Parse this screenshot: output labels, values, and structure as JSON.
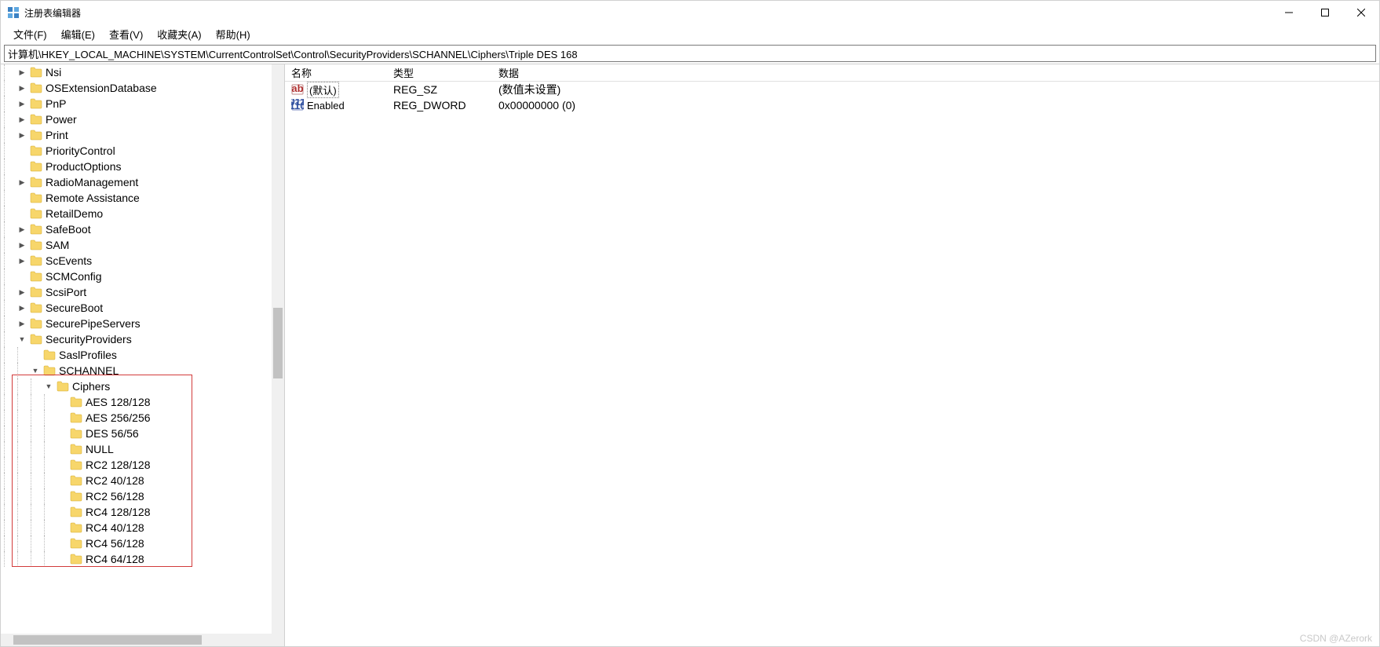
{
  "window": {
    "title": "注册表编辑器"
  },
  "menu": {
    "file": "文件(F)",
    "edit": "编辑(E)",
    "view": "查看(V)",
    "favorites": "收藏夹(A)",
    "help": "帮助(H)"
  },
  "address": "计算机\\HKEY_LOCAL_MACHINE\\SYSTEM\\CurrentControlSet\\Control\\SecurityProviders\\SCHANNEL\\Ciphers\\Triple DES 168",
  "tree": [
    {
      "depth": 1,
      "toggle": ">",
      "label": "Nsi"
    },
    {
      "depth": 1,
      "toggle": ">",
      "label": "OSExtensionDatabase"
    },
    {
      "depth": 1,
      "toggle": ">",
      "label": "PnP"
    },
    {
      "depth": 1,
      "toggle": ">",
      "label": "Power"
    },
    {
      "depth": 1,
      "toggle": ">",
      "label": "Print"
    },
    {
      "depth": 1,
      "toggle": "",
      "label": "PriorityControl"
    },
    {
      "depth": 1,
      "toggle": "",
      "label": "ProductOptions"
    },
    {
      "depth": 1,
      "toggle": ">",
      "label": "RadioManagement"
    },
    {
      "depth": 1,
      "toggle": "",
      "label": "Remote Assistance"
    },
    {
      "depth": 1,
      "toggle": "",
      "label": "RetailDemo"
    },
    {
      "depth": 1,
      "toggle": ">",
      "label": "SafeBoot"
    },
    {
      "depth": 1,
      "toggle": ">",
      "label": "SAM"
    },
    {
      "depth": 1,
      "toggle": ">",
      "label": "ScEvents"
    },
    {
      "depth": 1,
      "toggle": "",
      "label": "SCMConfig"
    },
    {
      "depth": 1,
      "toggle": ">",
      "label": "ScsiPort"
    },
    {
      "depth": 1,
      "toggle": ">",
      "label": "SecureBoot"
    },
    {
      "depth": 1,
      "toggle": ">",
      "label": "SecurePipeServers"
    },
    {
      "depth": 1,
      "toggle": "v",
      "label": "SecurityProviders"
    },
    {
      "depth": 2,
      "toggle": "",
      "label": "SaslProfiles"
    },
    {
      "depth": 2,
      "toggle": "v",
      "label": "SCHANNEL"
    },
    {
      "depth": 3,
      "toggle": "v",
      "label": "Ciphers"
    },
    {
      "depth": 4,
      "toggle": "",
      "label": "AES 128/128"
    },
    {
      "depth": 4,
      "toggle": "",
      "label": "AES 256/256"
    },
    {
      "depth": 4,
      "toggle": "",
      "label": "DES 56/56"
    },
    {
      "depth": 4,
      "toggle": "",
      "label": "NULL"
    },
    {
      "depth": 4,
      "toggle": "",
      "label": "RC2 128/128"
    },
    {
      "depth": 4,
      "toggle": "",
      "label": "RC2 40/128"
    },
    {
      "depth": 4,
      "toggle": "",
      "label": "RC2 56/128"
    },
    {
      "depth": 4,
      "toggle": "",
      "label": "RC4 128/128"
    },
    {
      "depth": 4,
      "toggle": "",
      "label": "RC4 40/128"
    },
    {
      "depth": 4,
      "toggle": "",
      "label": "RC4 56/128"
    },
    {
      "depth": 4,
      "toggle": "",
      "label": "RC4 64/128"
    }
  ],
  "columns": {
    "name": "名称",
    "type": "类型",
    "data": "数据"
  },
  "col_widths": {
    "name": 130,
    "type": 134,
    "data": 900
  },
  "values": [
    {
      "icon": "string",
      "name": "(默认)",
      "is_default": true,
      "type": "REG_SZ",
      "data": "(数值未设置)"
    },
    {
      "icon": "binary",
      "name": "Enabled",
      "is_default": false,
      "type": "REG_DWORD",
      "data": "0x00000000 (0)"
    }
  ],
  "watermark": "CSDN @AZerork"
}
